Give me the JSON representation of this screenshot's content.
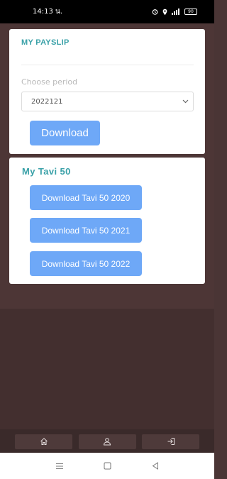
{
  "status_bar": {
    "time": "14:13 น.",
    "battery": "90"
  },
  "payslip": {
    "title": "MY PAYSLIP",
    "period_label": "Choose period",
    "period_value": "2022121",
    "download_label": "Download"
  },
  "tavi": {
    "title": "My Tavi 50",
    "buttons": [
      {
        "label": "Download Tavi 50 2020"
      },
      {
        "label": "Download Tavi 50 2021"
      },
      {
        "label": "Download Tavi 50 2022"
      }
    ]
  },
  "bottom_nav": {
    "items": [
      {
        "icon": "home-icon"
      },
      {
        "icon": "user-icon"
      },
      {
        "icon": "logout-icon"
      }
    ]
  },
  "system_nav": {
    "items": [
      {
        "icon": "recent-apps-icon"
      },
      {
        "icon": "home-square-icon"
      },
      {
        "icon": "back-icon"
      }
    ]
  },
  "colors": {
    "accent_teal": "#3aa1a8",
    "button_blue": "#6ea8f7",
    "background": "#4a3535"
  }
}
